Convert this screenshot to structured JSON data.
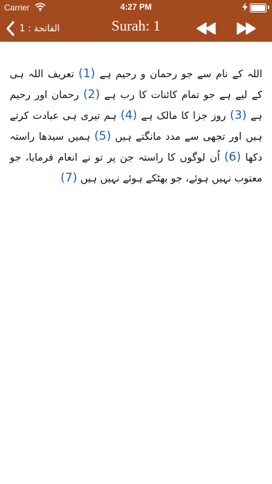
{
  "status_bar": {
    "carrier": "Carrier",
    "time": "4:27 PM"
  },
  "nav": {
    "back_label": "الفاتحة : 1",
    "title": "Surah: 1"
  },
  "colors": {
    "bar": "#a34a1e",
    "ayah_number": "#1f5fa8"
  },
  "icons": [
    "wifi-icon",
    "battery-icon",
    "chevron-left-icon",
    "rewind-icon",
    "fast-forward-icon"
  ],
  "verses": [
    {
      "text": "اللہ کے نام سے جو رحمان و رحیم ہے",
      "number": "(1)"
    },
    {
      "text": "تعریف اللہ ہی کے لیے ہے جو تمام کائنات کا رب ہے",
      "number": "(2)"
    },
    {
      "text": "رحمان اور رحیم ہے",
      "number": "(3)"
    },
    {
      "text": "روز جزا کا مالک ہے",
      "number": "(4)"
    },
    {
      "text": "ہم تیری ہی عبادت کرتے ہیں اور تجھی سے مدد مانگتے ہیں",
      "number": "(5)"
    },
    {
      "text": "ہمیں سیدھا راستہ دکھا",
      "number": "(6)"
    },
    {
      "text": "اُن لوگوں کا راستہ جن پر تو نے انعام فرمایا، جو معتوب نہیں ہوئے، جو بھٹکے ہوئے نہیں ہیں",
      "number": "(7)"
    }
  ]
}
